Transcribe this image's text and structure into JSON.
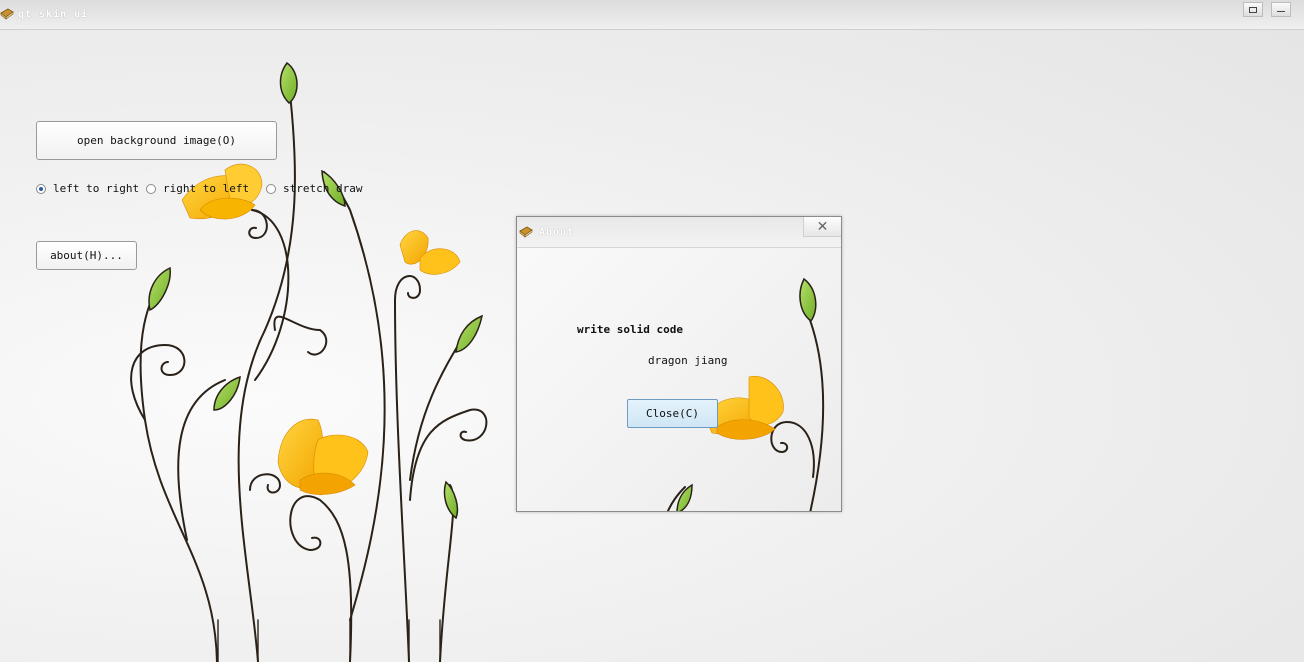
{
  "window": {
    "title": "qt skin ui",
    "icon": "book-icon",
    "buttons": [
      "restore-icon",
      "minimize-icon"
    ]
  },
  "main": {
    "open_button": "open background image(O)",
    "radio_options": [
      {
        "label": "left to right",
        "checked": true
      },
      {
        "label": "right to left",
        "checked": false
      },
      {
        "label": "stretch draw",
        "checked": false
      }
    ],
    "about_button": "about(H)..."
  },
  "dialog": {
    "title": "About",
    "close_icon": "close-icon",
    "heading": "write solid code",
    "author": "dragon jiang",
    "close_button": "Close(C)"
  },
  "colors": {
    "petal": "#ffc21a",
    "petal_dark": "#f4a400",
    "leaf": "#8cc63f",
    "stem": "#2a2218",
    "radio_accent": "#2a5aa8",
    "dialog_button": "#d6ebf8"
  }
}
